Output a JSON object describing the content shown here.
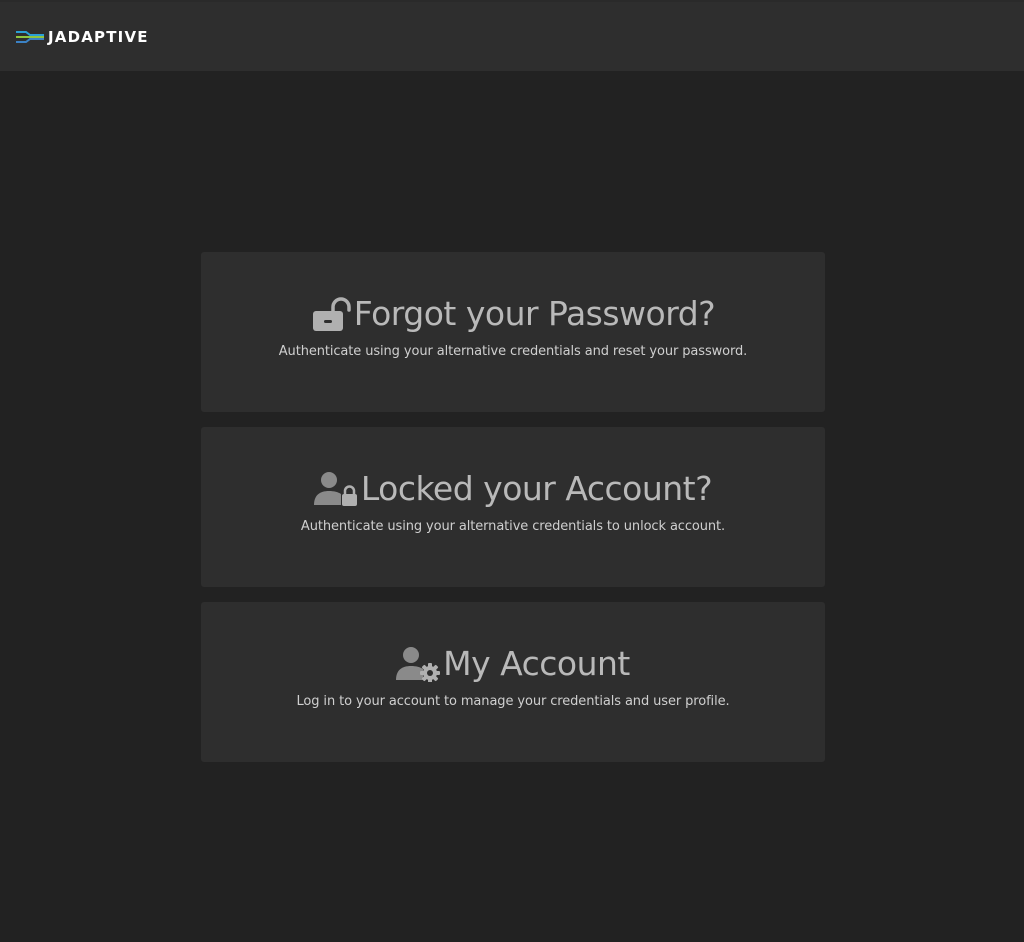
{
  "header": {
    "brand": "JADAPTIVE",
    "logo_colors": [
      "#2a9fd6",
      "#8fc63f",
      "#3b82c4"
    ]
  },
  "cards": [
    {
      "icon": "unlocked-padlock-icon",
      "title": "Forgot your Password?",
      "description": "Authenticate using your alternative credentials and reset your password."
    },
    {
      "icon": "user-lock-icon",
      "title": "Locked your Account?",
      "description": "Authenticate using your alternative credentials to unlock account."
    },
    {
      "icon": "user-gear-icon",
      "title": "My Account",
      "description": "Log in to your account to manage your credentials and user profile."
    }
  ],
  "colors": {
    "background": "#222222",
    "panel": "#2e2e2e",
    "icon": "#b0b0b0"
  }
}
